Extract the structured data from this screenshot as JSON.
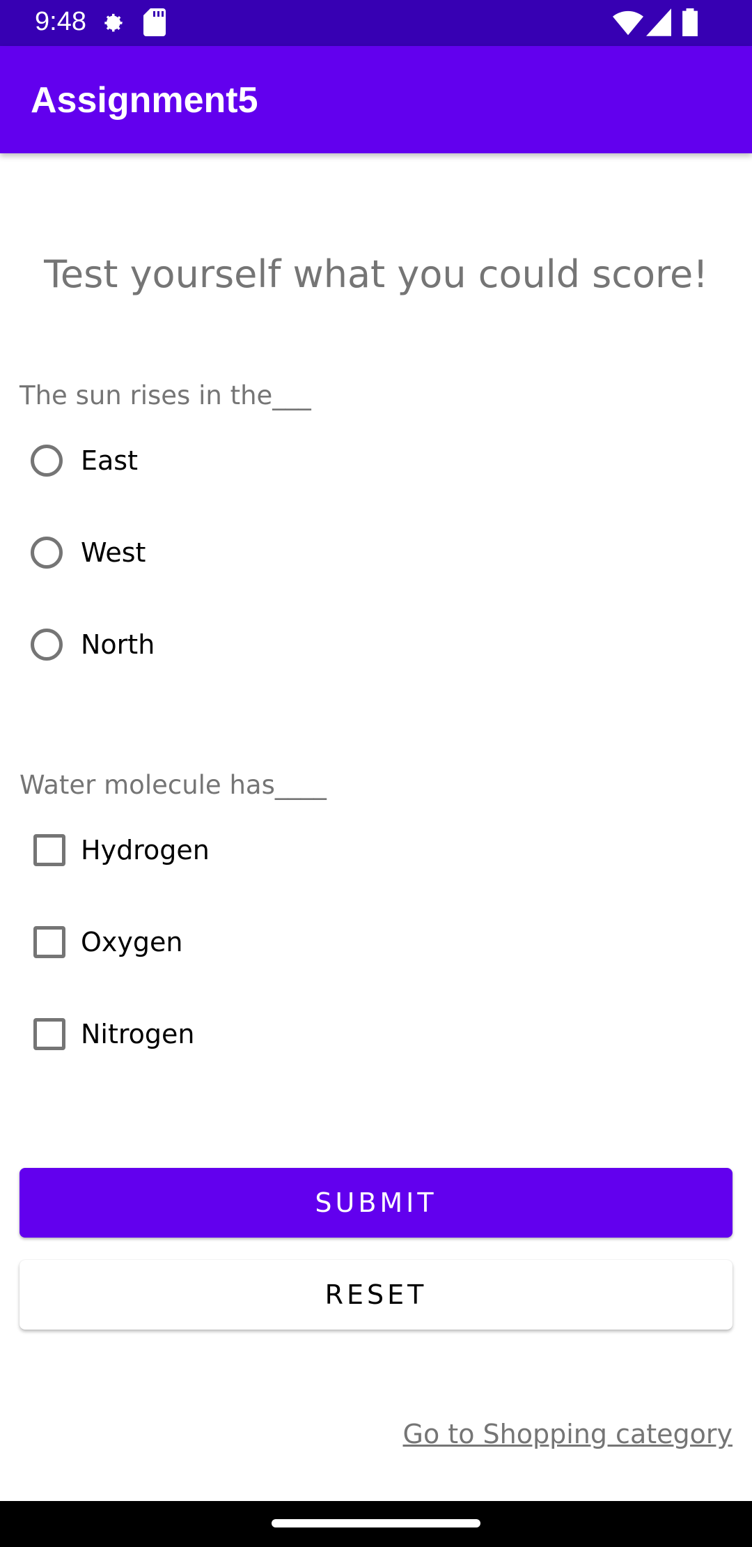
{
  "status_bar": {
    "time": "9:48"
  },
  "app_bar": {
    "title": "Assignment5"
  },
  "heading": "Test yourself what you could score!",
  "question1": {
    "text": "The sun rises in the___",
    "options": [
      "East",
      "West",
      "North"
    ]
  },
  "question2": {
    "text": "Water molecule has____",
    "options": [
      "Hydrogen",
      "Oxygen",
      "Nitrogen"
    ]
  },
  "buttons": {
    "submit": "SUBMIT",
    "reset": "RESET"
  },
  "link": "Go to Shopping category",
  "colors": {
    "primary": "#6200ee",
    "primary_dark": "#3700b3",
    "text_secondary": "#757575"
  }
}
